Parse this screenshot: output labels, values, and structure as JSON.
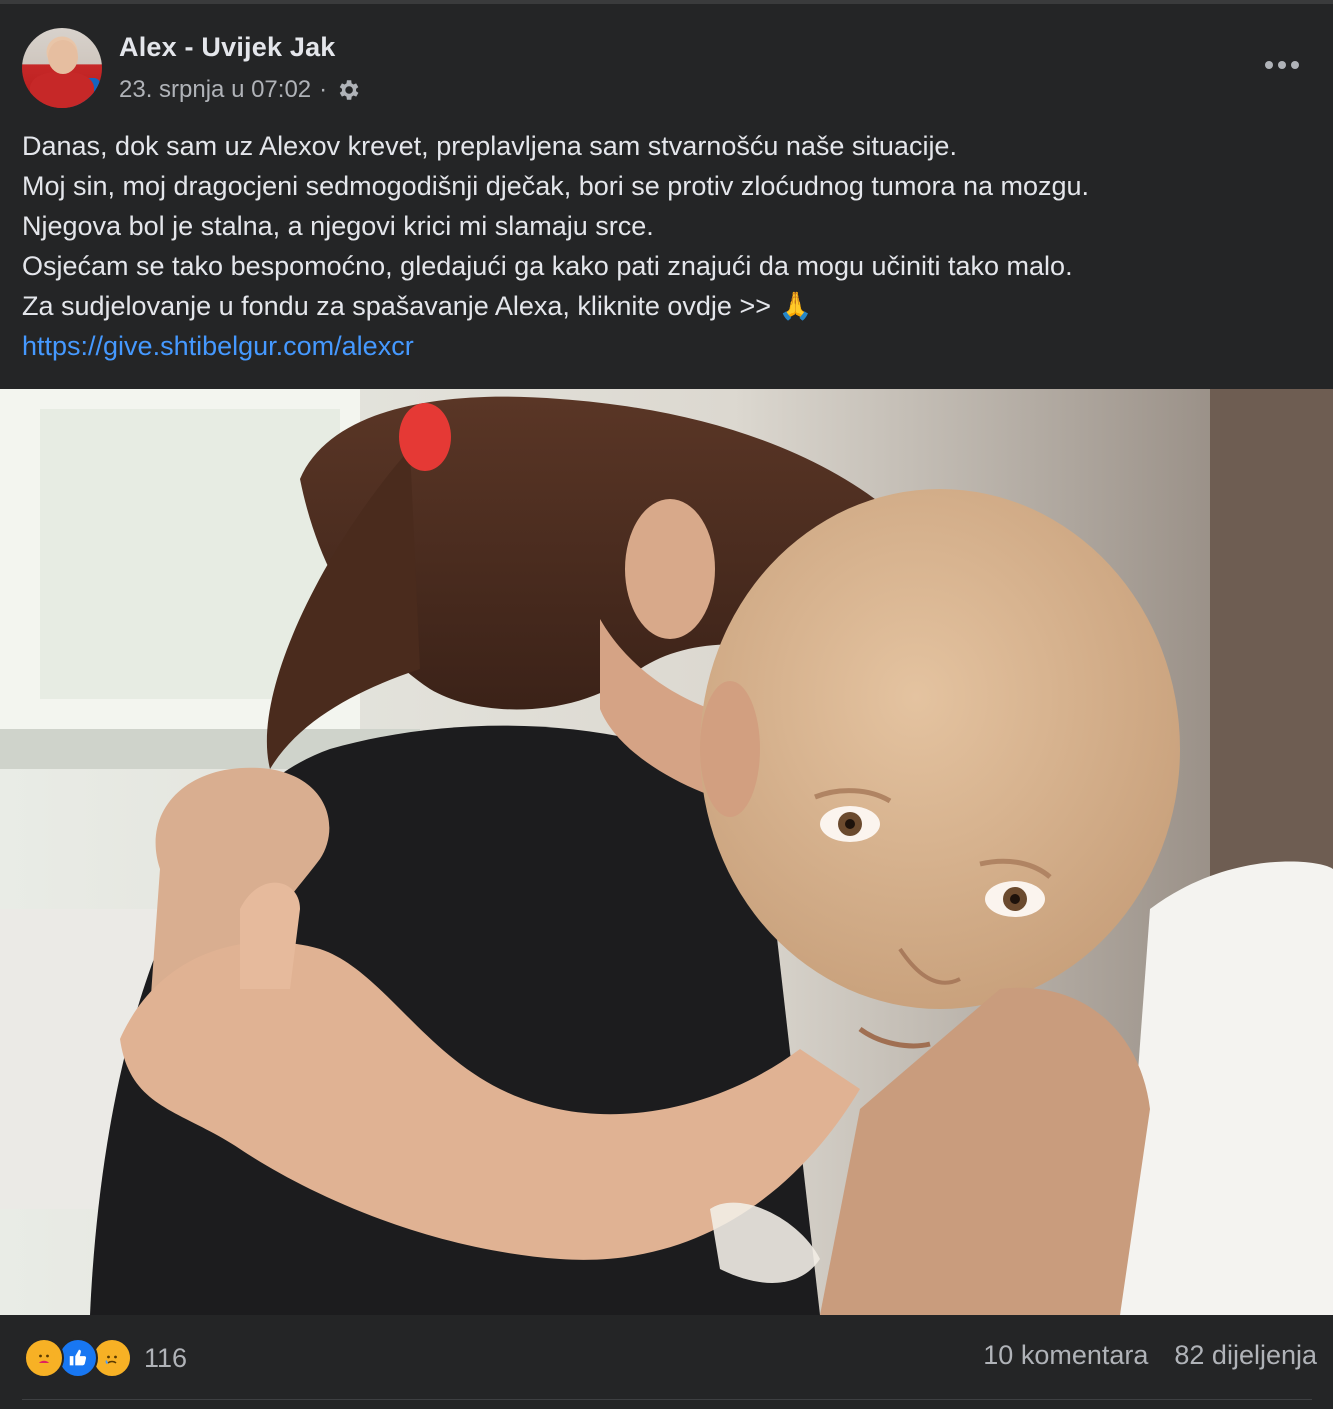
{
  "post": {
    "author": "Alex - Uvijek Jak",
    "timestamp": "23. srpnja u 07:02",
    "separator": "·",
    "privacy_icon": "gear-icon",
    "more_icon": "more-options-icon",
    "text_lines": [
      "Danas, dok sam uz Alexov krevet, preplavljena sam stvarnošću naše situacije.",
      "Moj sin, moj dragocjeni sedmogodišnji dječak, bori se protiv zloćudnog tumora na mozgu.",
      "Njegova bol je stalna, a njegovi krici mi slamaju srce.",
      "Osjećam se tako bespomoćno, gledajući ga kako pati znajući da mogu učiniti tako malo.",
      "Za sudjelovanje u fondu za spašavanje Alexa, kliknite ovdje >> 🙏"
    ],
    "link": "https://give.shtibelgur.com/alexcr"
  },
  "footer": {
    "reaction_icons": [
      "care-reaction-icon",
      "like-reaction-icon",
      "sad-reaction-icon"
    ],
    "reaction_count": "116",
    "comments": "10 komentara",
    "shares": "82 dijeljenja"
  },
  "colors": {
    "background": "#242526",
    "text": "#e4e6eb",
    "secondary_text": "#b0b3b8",
    "link": "#4599ff",
    "like_blue": "#1877f2",
    "reaction_yellow": "#f7b125"
  }
}
